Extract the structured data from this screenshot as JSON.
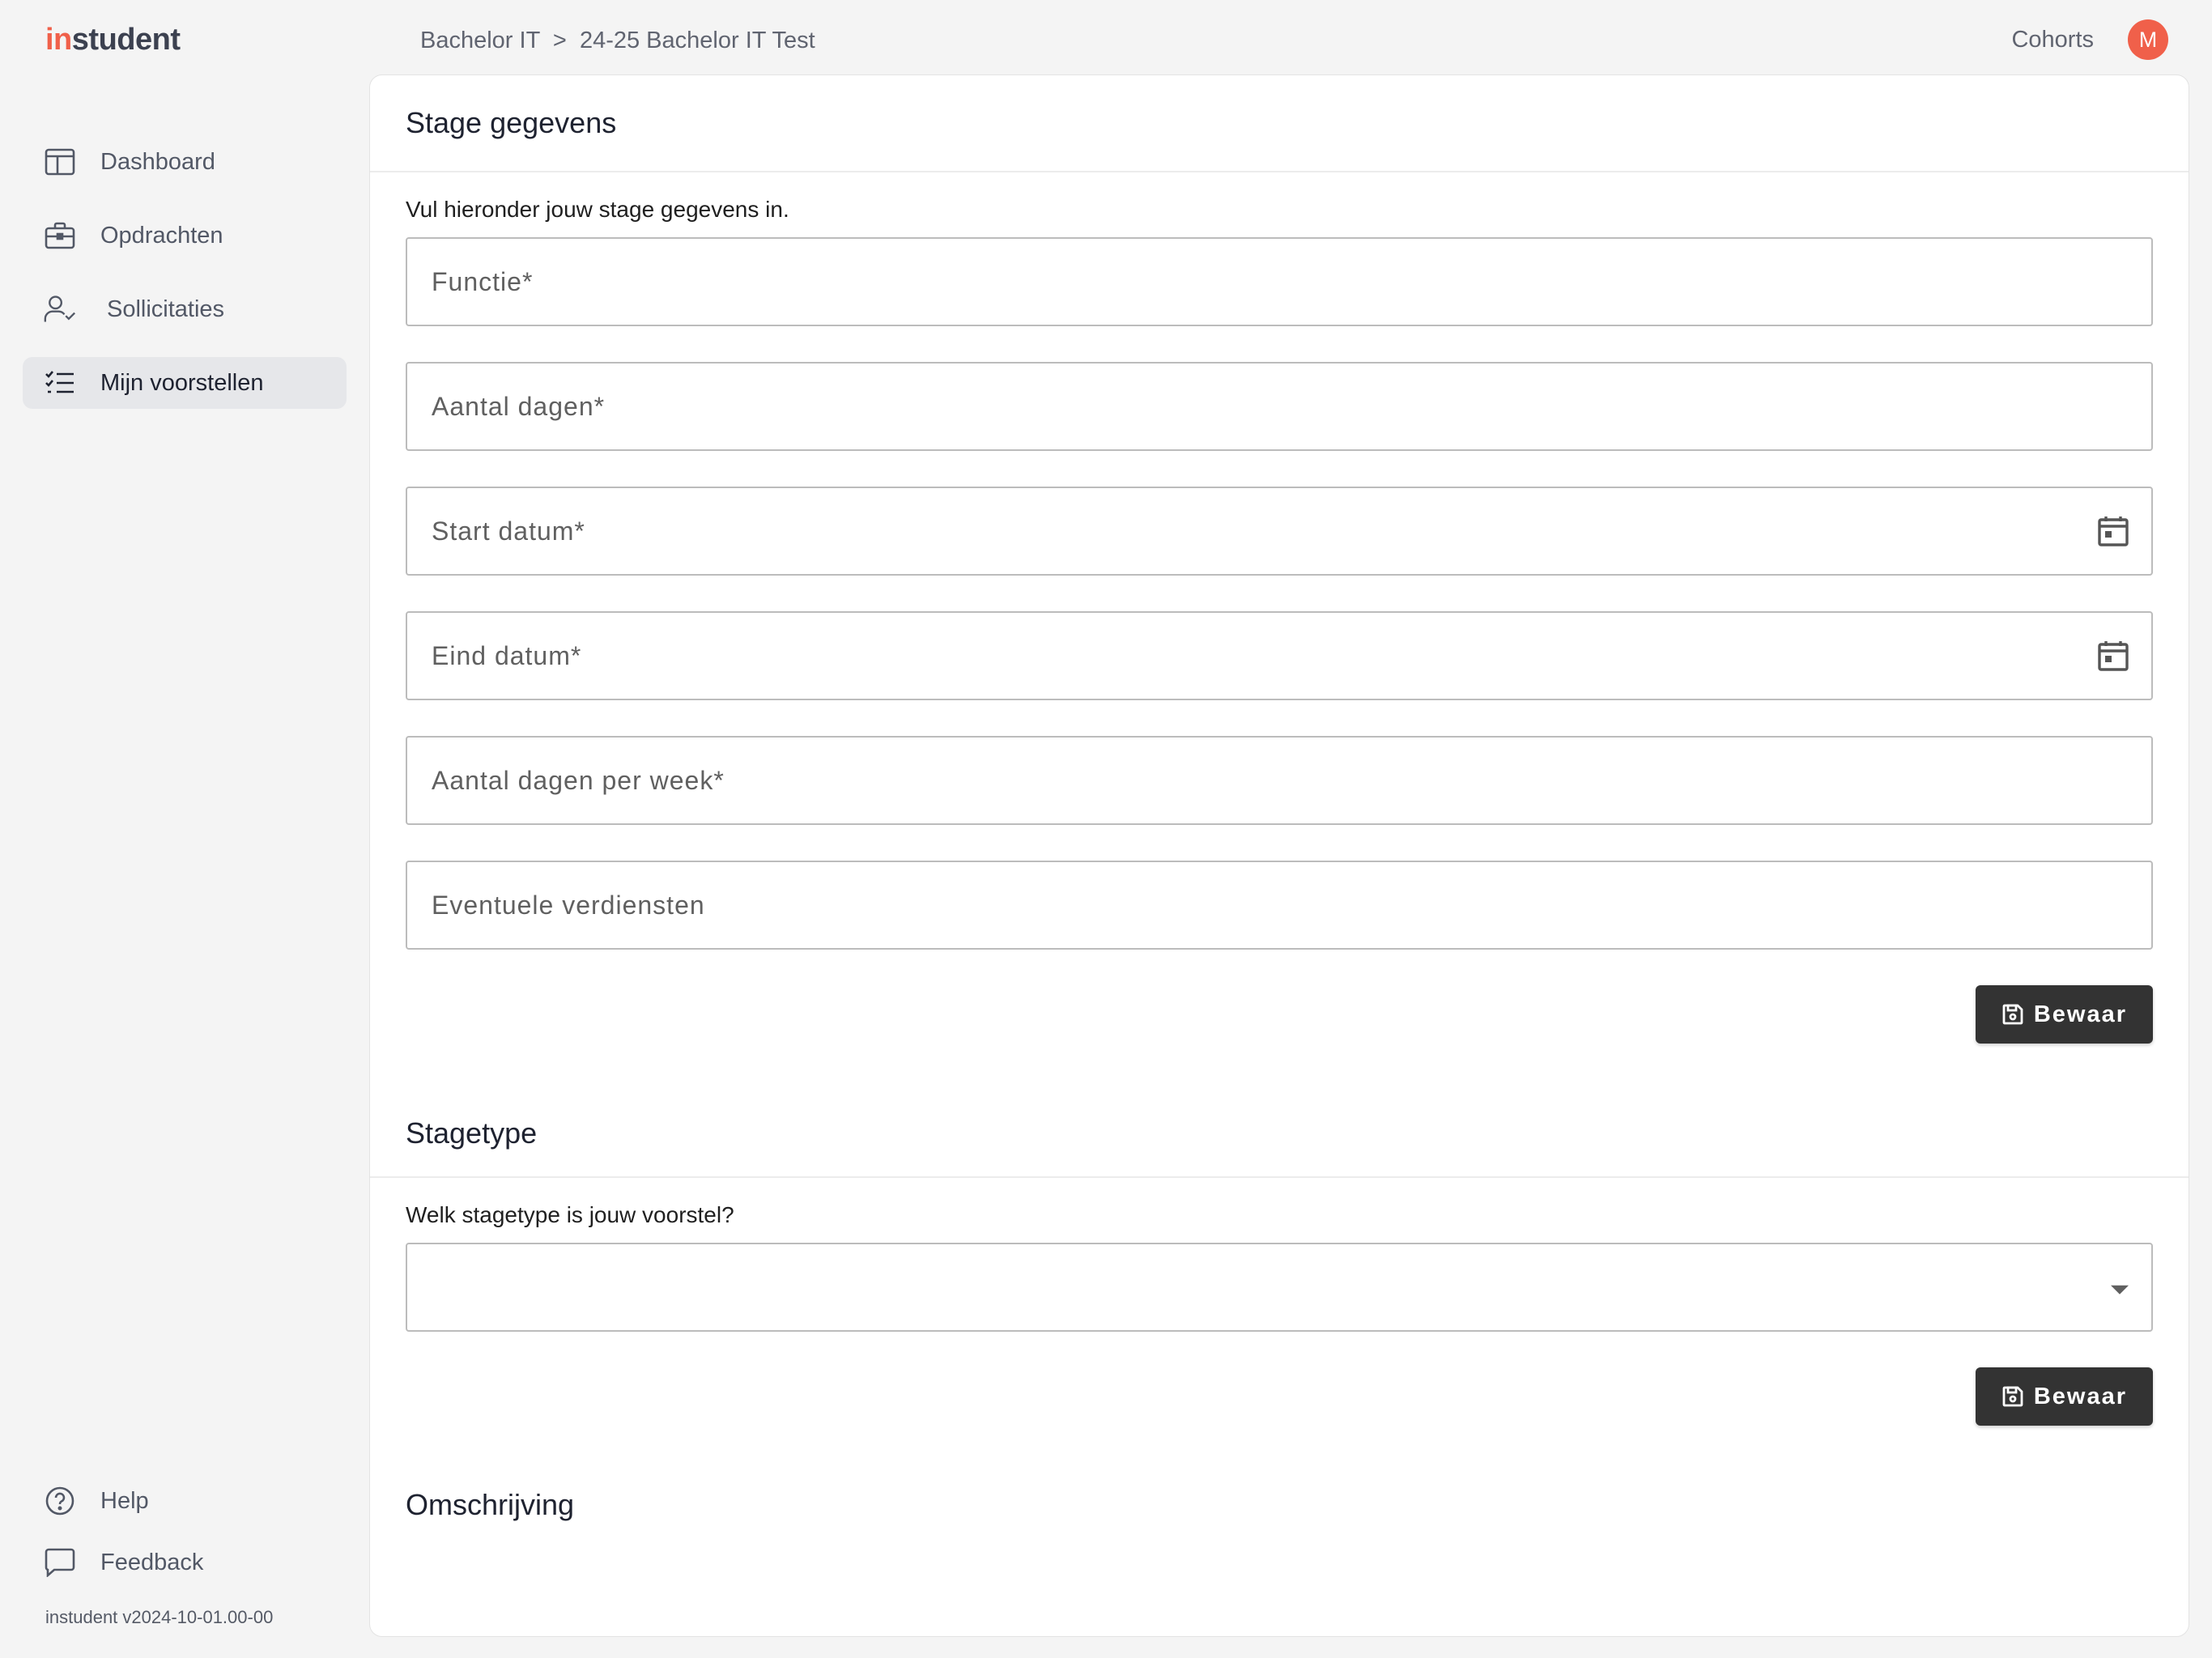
{
  "logo": {
    "part1": "in",
    "part2": "student"
  },
  "breadcrumb": {
    "items": [
      "Bachelor IT",
      "24-25 Bachelor IT Test"
    ],
    "separator": ">"
  },
  "header": {
    "cohorts_label": "Cohorts",
    "avatar_initial": "M"
  },
  "sidebar": {
    "items": [
      {
        "label": "Dashboard",
        "icon": "dashboard-icon"
      },
      {
        "label": "Opdrachten",
        "icon": "briefcase-icon"
      },
      {
        "label": "Sollicitaties",
        "icon": "user-check-icon"
      },
      {
        "label": "Mijn voorstellen",
        "icon": "checklist-icon",
        "active": true
      }
    ],
    "bottom": [
      {
        "label": "Help",
        "icon": "help-icon"
      },
      {
        "label": "Feedback",
        "icon": "message-icon"
      }
    ],
    "version": "instudent v2024-10-01.00-00"
  },
  "stage_gegevens": {
    "title": "Stage gegevens",
    "hint": "Vul hieronder jouw stage gegevens in.",
    "fields": [
      {
        "label": "Functie*",
        "value": ""
      },
      {
        "label": "Aantal dagen*",
        "value": ""
      },
      {
        "label": "Start datum*",
        "value": "",
        "icon": "calendar-icon"
      },
      {
        "label": "Eind datum*",
        "value": "",
        "icon": "calendar-icon"
      },
      {
        "label": "Aantal dagen per week*",
        "value": ""
      },
      {
        "label": "Eventuele verdiensten",
        "value": ""
      }
    ],
    "save_label": "Bewaar"
  },
  "stagetype": {
    "title": "Stagetype",
    "hint": "Welk stagetype is jouw voorstel?",
    "selected": "",
    "save_label": "Bewaar"
  },
  "omschrijving": {
    "title": "Omschrijving"
  },
  "colors": {
    "brand": "#f0604a",
    "button": "#333333",
    "active_nav": "#e6e7ea"
  }
}
